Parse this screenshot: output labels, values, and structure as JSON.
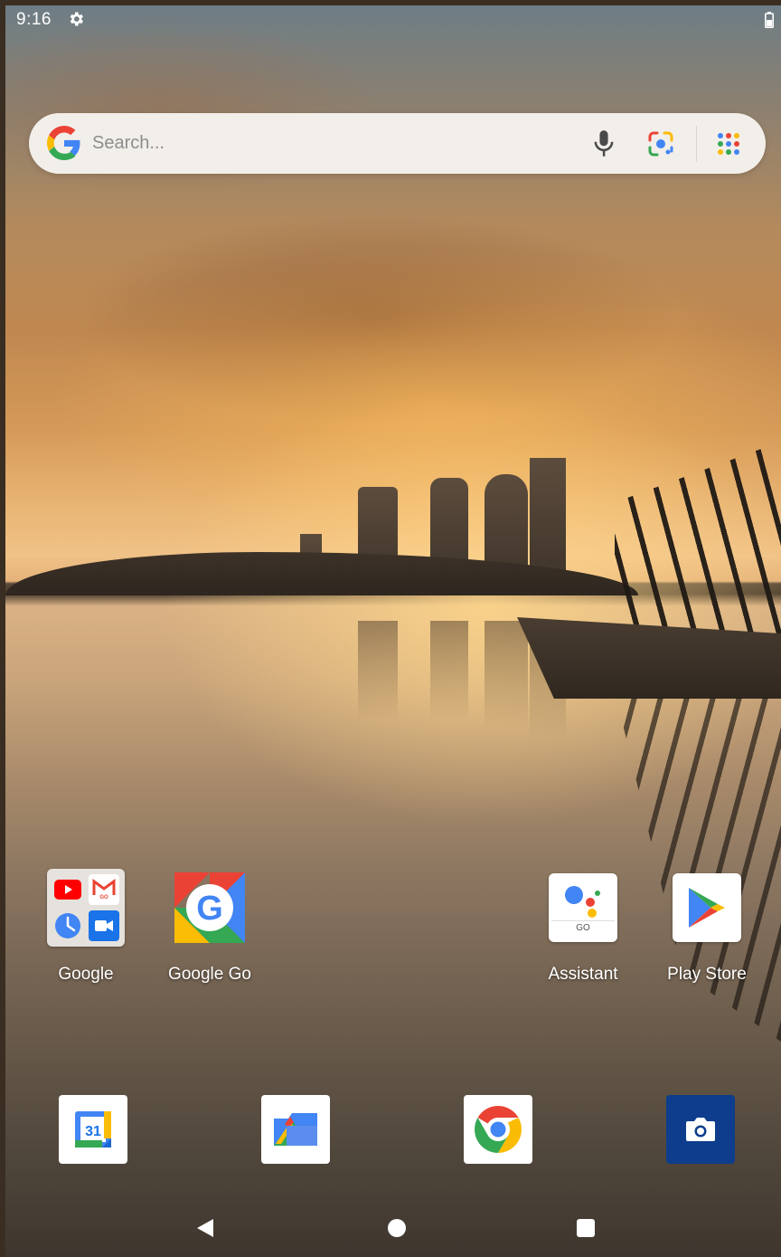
{
  "status_bar": {
    "time": "9:16",
    "icons": [
      "gear-icon",
      "battery-icon"
    ]
  },
  "search_bar": {
    "placeholder": "Search...",
    "icons": [
      "google-g-icon",
      "mic-icon",
      "lens-icon",
      "apps-grid-icon"
    ]
  },
  "home_apps": [
    {
      "label": "Google",
      "icon": "google-folder-icon",
      "folder_contents": [
        "youtube-icon",
        "gmail-go-icon",
        "clock-icon",
        "meet-icon"
      ]
    },
    {
      "label": "Google Go",
      "icon": "google-go-icon"
    },
    {
      "label": "Assistant",
      "icon": "assistant-go-icon",
      "badge": "GO"
    },
    {
      "label": "Play Store",
      "icon": "play-store-icon"
    }
  ],
  "dock": [
    {
      "icon": "calendar-icon",
      "text": "31"
    },
    {
      "icon": "files-icon"
    },
    {
      "icon": "chrome-icon"
    },
    {
      "icon": "camera-icon"
    }
  ],
  "nav_bar": {
    "buttons": [
      "back-button",
      "home-button",
      "recents-button"
    ]
  },
  "colors": {
    "google_blue": "#4285F4",
    "google_red": "#EA4335",
    "google_yellow": "#FBBC05",
    "google_green": "#34A853",
    "camera_bg": "#0d3d8c"
  }
}
